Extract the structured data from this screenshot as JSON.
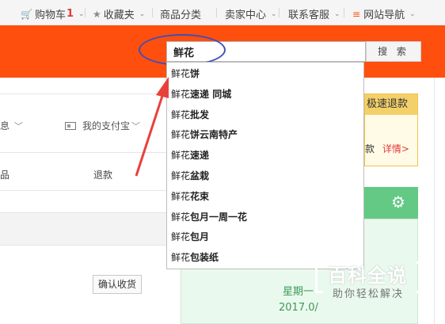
{
  "topnav": {
    "cart_label": "购物车",
    "cart_count": "1",
    "favorites": "收藏夹",
    "categories": "商品分类",
    "seller_center": "卖家中心",
    "contact_service": "联系客服",
    "site_nav": "网站导航",
    "chevron": "⌄"
  },
  "search": {
    "value": "鲜花",
    "button_label": "搜 索"
  },
  "suggestions": [
    {
      "prefix": "鲜花",
      "suffix": "饼"
    },
    {
      "prefix": "鲜花",
      "suffix": "速递 同城"
    },
    {
      "prefix": "鲜花",
      "suffix": "批发"
    },
    {
      "prefix": "鲜花",
      "suffix": "饼云南特产"
    },
    {
      "prefix": "鲜花",
      "suffix": "速递"
    },
    {
      "prefix": "鲜花",
      "suffix": "盆栽"
    },
    {
      "prefix": "鲜花",
      "suffix": "花束"
    },
    {
      "prefix": "鲜花",
      "suffix": "包月一周一花"
    },
    {
      "prefix": "鲜花",
      "suffix": "包月"
    },
    {
      "prefix": "鲜花",
      "suffix": "包装纸"
    }
  ],
  "left": {
    "info_fragment": "息",
    "alipay": "我的支付宝",
    "tab_fragment": "品",
    "refund": "退款",
    "confirm_receipt": "确认收货"
  },
  "right": {
    "speed_refund": "极速退款",
    "refund_fragment": "款",
    "detail_link": "详情>",
    "gear": "⚙",
    "weekday": "星期一",
    "date": "2017.0/"
  },
  "watermark": {
    "title": "百科全说",
    "subtitle": "助你轻松解决"
  },
  "colors": {
    "accent": "#ff4f0e",
    "annotation_circle": "#3e4fb8",
    "arrow": "#e8413c",
    "green": "#63c984"
  }
}
